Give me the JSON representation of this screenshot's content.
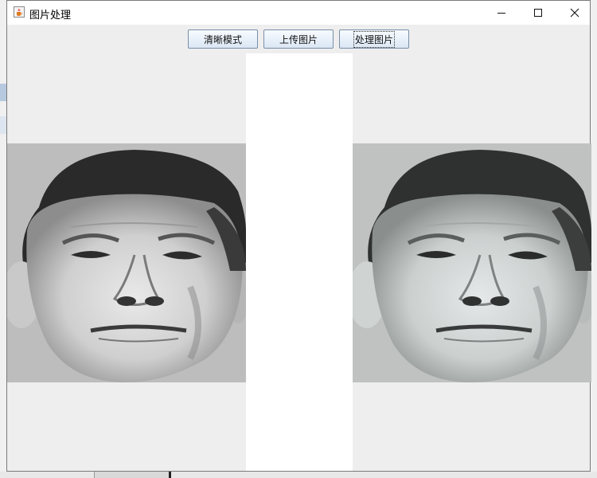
{
  "window": {
    "title": "图片处理",
    "app_icon": "java-cup-icon"
  },
  "toolbar": {
    "clear_mode_label": "清晰模式",
    "upload_label": "上传图片",
    "process_label": "处理图片"
  },
  "images": {
    "original": "portrait-original",
    "processed": "portrait-processed"
  },
  "colors": {
    "window_bg": "#eeeeee",
    "button_border": "#7a8fa8",
    "center_panel": "#ffffff"
  }
}
